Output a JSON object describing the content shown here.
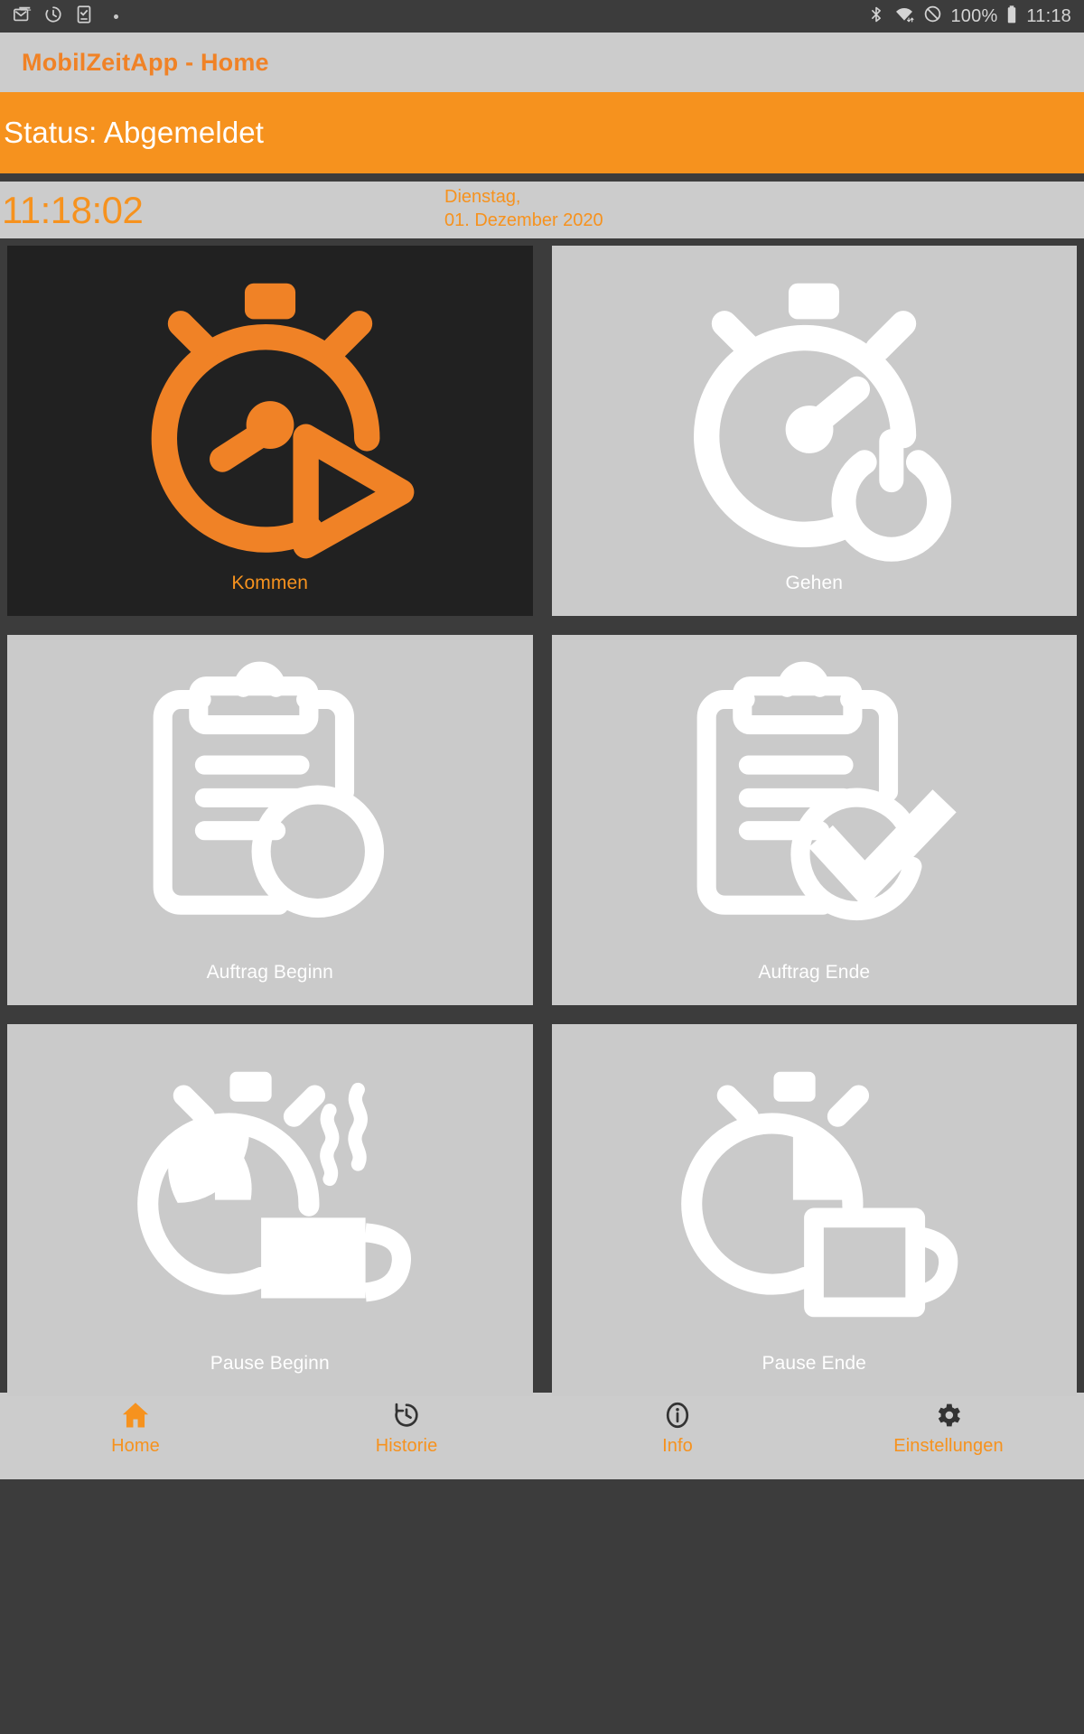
{
  "system_status_bar": {
    "left_icons": [
      "mail-icon",
      "clock-history-icon",
      "task-checkbox-icon",
      "notification-dot-icon"
    ],
    "right_icons": [
      "bluetooth-icon",
      "wifi-icon",
      "do-not-disturb-icon",
      "battery-icon"
    ],
    "battery_percent": "100%",
    "clock": "11:18"
  },
  "appbar": {
    "title": "MobilZeitApp - Home"
  },
  "status_band": {
    "text": "Status: Abgemeldet",
    "background_color": "#f6921e",
    "text_color": "#ffffff"
  },
  "clock_row": {
    "time": "11:18:02",
    "weekday": "Dienstag,",
    "date": "01. Dezember 2020",
    "accent_color": "#f6921e"
  },
  "tiles": [
    {
      "id": "kommen",
      "label": "Kommen",
      "icon": "alarm-clock-play-icon",
      "active": true,
      "background_color": "#212121",
      "foreground_color": "#f6921e"
    },
    {
      "id": "gehen",
      "label": "Gehen",
      "icon": "alarm-clock-power-icon",
      "active": false,
      "background_color": "#cacaca",
      "foreground_color": "#ffffff"
    },
    {
      "id": "auftrag-beginn",
      "label": "Auftrag Beginn",
      "icon": "clipboard-circle-icon",
      "active": false,
      "background_color": "#cacaca",
      "foreground_color": "#ffffff"
    },
    {
      "id": "auftrag-ende",
      "label": "Auftrag Ende",
      "icon": "clipboard-check-icon",
      "active": false,
      "background_color": "#cacaca",
      "foreground_color": "#ffffff"
    },
    {
      "id": "pause-beginn",
      "label": "Pause Beginn",
      "icon": "clock-hot-coffee-icon",
      "active": false,
      "background_color": "#cacaca",
      "foreground_color": "#ffffff"
    },
    {
      "id": "pause-ende",
      "label": "Pause Ende",
      "icon": "clock-empty-cup-icon",
      "active": false,
      "background_color": "#cacaca",
      "foreground_color": "#ffffff"
    }
  ],
  "bottom_nav": {
    "items": [
      {
        "id": "home",
        "label": "Home",
        "icon": "home-icon",
        "active": true
      },
      {
        "id": "historie",
        "label": "Historie",
        "icon": "history-icon",
        "active": false
      },
      {
        "id": "info",
        "label": "Info",
        "icon": "info-icon",
        "active": false
      },
      {
        "id": "einstellungen",
        "label": "Einstellungen",
        "icon": "gear-icon",
        "active": false
      }
    ]
  }
}
